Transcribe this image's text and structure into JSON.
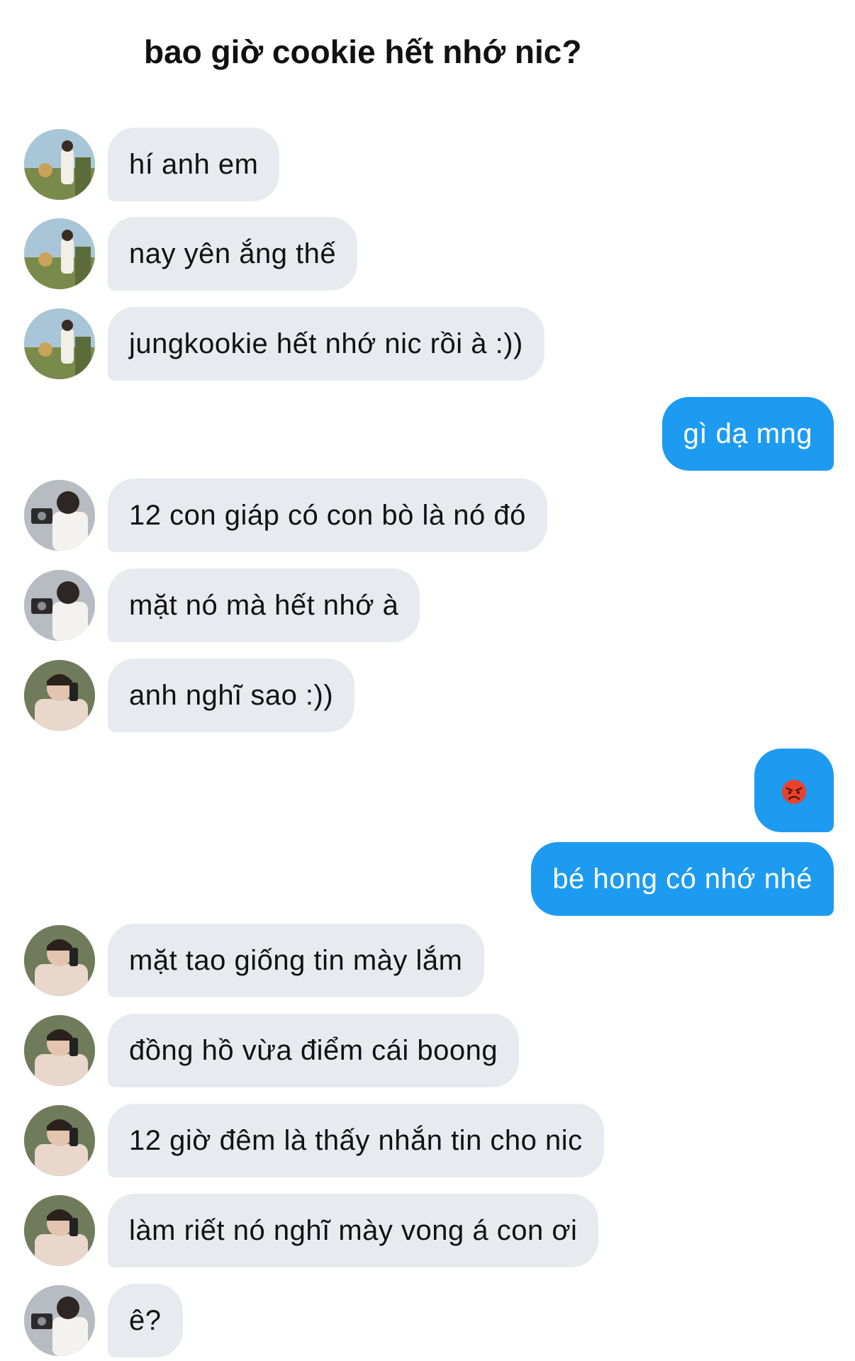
{
  "header": {
    "title": "bao giờ cookie hết nhớ nic?"
  },
  "messages": [
    {
      "id": "m1",
      "side": "in",
      "avatar": "avatar-outdoor",
      "text": "hí anh em"
    },
    {
      "id": "m2",
      "side": "in",
      "avatar": "avatar-outdoor",
      "text": "nay yên ắng thế"
    },
    {
      "id": "m3",
      "side": "in",
      "avatar": "avatar-outdoor",
      "text": "jungkookie hết nhớ nic rồi à :))"
    },
    {
      "id": "m4",
      "side": "out",
      "text": "gì dạ mng"
    },
    {
      "id": "m5",
      "side": "in",
      "avatar": "avatar-camera",
      "text": "12 con giáp có con bò là nó đó"
    },
    {
      "id": "m6",
      "side": "in",
      "avatar": "avatar-camera",
      "text": "mặt nó mà hết nhớ à"
    },
    {
      "id": "m7",
      "side": "in",
      "avatar": "avatar-phone",
      "text": "anh nghĩ sao :))"
    },
    {
      "id": "m8",
      "side": "out",
      "emoji": "angry-face",
      "text": ""
    },
    {
      "id": "m9",
      "side": "out",
      "text": "bé hong có nhớ nhé"
    },
    {
      "id": "m10",
      "side": "in",
      "avatar": "avatar-phone",
      "text": "mặt tao giống tin mày lắm"
    },
    {
      "id": "m11",
      "side": "in",
      "avatar": "avatar-phone",
      "text": "đồng hồ vừa điểm cái boong"
    },
    {
      "id": "m12",
      "side": "in",
      "avatar": "avatar-phone",
      "text": "12 giờ đêm là thấy nhắn tin cho nic"
    },
    {
      "id": "m13",
      "side": "in",
      "avatar": "avatar-phone",
      "text": "làm riết nó nghĩ mày vong á con ơi"
    },
    {
      "id": "m14",
      "side": "in",
      "avatar": "avatar-camera",
      "text": "ê?"
    }
  ],
  "colors": {
    "incoming_bubble": "#e7ebef",
    "outgoing_bubble": "#1d9bf0",
    "outgoing_text": "#ffffff",
    "incoming_text": "#111111"
  }
}
